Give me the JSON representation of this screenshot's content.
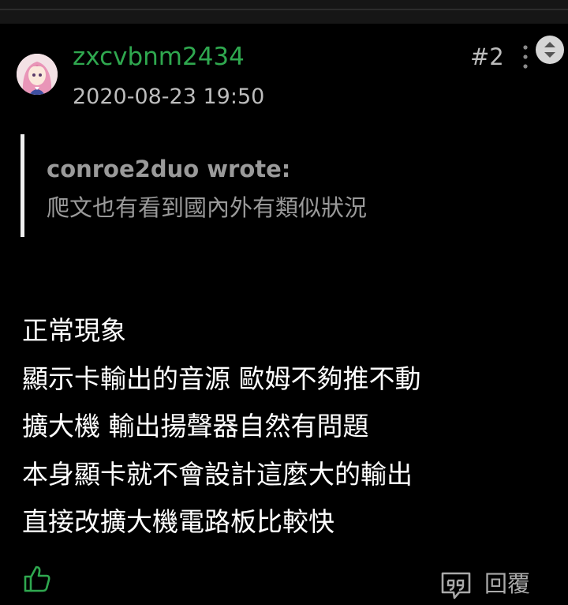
{
  "post": {
    "username": "zxcvbnm2434",
    "timestamp": "2020-08-23 19:50",
    "floor": "#2",
    "quote": {
      "author": "conroe2duo wrote:",
      "text": "爬文也有看到國內外有類似狀況"
    },
    "content_lines": [
      "正常現象",
      "顯示卡輸出的音源 歐姆不夠推不動",
      "擴大機 輸出揚聲器自然有問題",
      "本身顯卡就不會設計這麼大的輸出",
      "直接改擴大機電路板比較快"
    ],
    "actions": {
      "like_icon": "thumbs-up-icon",
      "quote_reply_icon": "quote-reply-icon",
      "reply_label": "回覆"
    }
  },
  "colors": {
    "background": "#000000",
    "username": "#2fa84f",
    "like_icon": "#2fa84f",
    "muted_text": "#bdbdbd",
    "quote_text": "#9a9a9a",
    "body_text": "#ffffff"
  }
}
